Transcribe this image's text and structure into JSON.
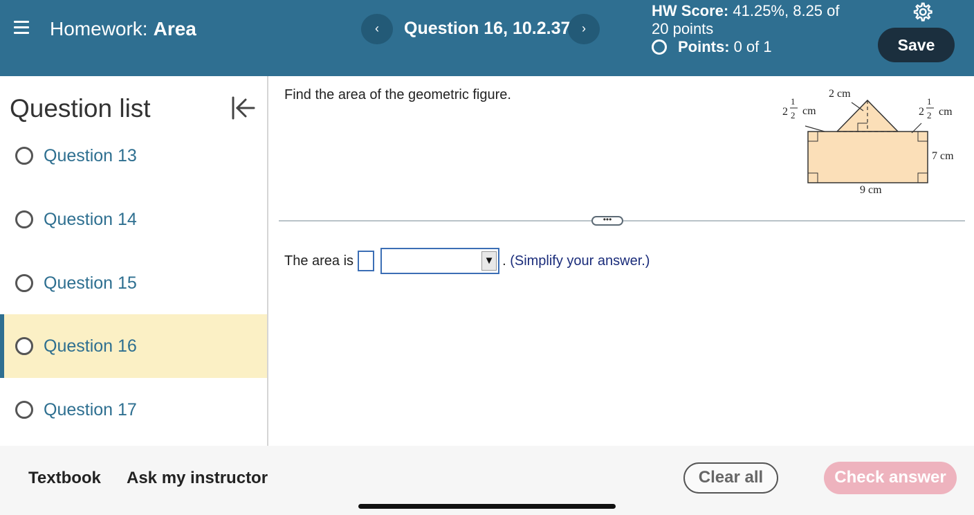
{
  "header": {
    "title_prefix": "Homework:",
    "title_topic": "Area",
    "question_title": "Question 16, 10.2.37",
    "prev_glyph": "‹",
    "next_glyph": "›",
    "hw_score_label": "HW Score:",
    "hw_score_value": "41.25%, 8.25 of 20 points",
    "points_label": "Points:",
    "points_value": "0 of 1",
    "save_label": "Save",
    "colors": {
      "bar": "#2f6f91",
      "save": "#1b2f3e"
    }
  },
  "sidebar": {
    "title": "Question list",
    "items": [
      {
        "label": "Question 13",
        "active": false
      },
      {
        "label": "Question 14",
        "active": false
      },
      {
        "label": "Question 15",
        "active": false
      },
      {
        "label": "Question 16",
        "active": true
      },
      {
        "label": "Question 17",
        "active": false
      }
    ]
  },
  "main": {
    "prompt": "Find the area of the geometric figure.",
    "figure": {
      "left_whole": "2",
      "left_num": "1",
      "left_den": "2",
      "left_unit": "cm",
      "top_label": "2 cm",
      "right_whole": "2",
      "right_num": "1",
      "right_den": "2",
      "right_unit": "cm",
      "side_label": "7 cm",
      "bottom_label": "9 cm"
    },
    "divider_handle": "•••",
    "answer_prefix": "The area is",
    "answer_value": "",
    "unit_selected": "",
    "answer_dot": ".",
    "answer_suffix": "(Simplify your answer.)"
  },
  "footer": {
    "textbook": "Textbook",
    "ask": "Ask my instructor",
    "clear": "Clear all",
    "check": "Check answer"
  }
}
